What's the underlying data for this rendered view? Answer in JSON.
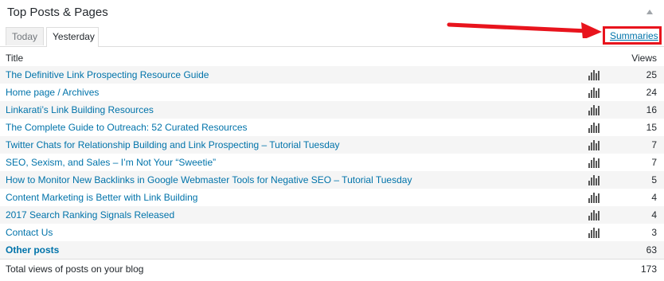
{
  "widget": {
    "title": "Top Posts & Pages"
  },
  "tabs": [
    {
      "label": "Today"
    },
    {
      "label": "Yesterday",
      "active": true
    }
  ],
  "summaries_label": "Summaries",
  "table": {
    "columns": {
      "title": "Title",
      "views": "Views"
    },
    "rows": [
      {
        "title": "The Definitive Link Prospecting Resource Guide",
        "views": "25"
      },
      {
        "title": "Home page / Archives",
        "views": "24"
      },
      {
        "title": "Linkarati’s Link Building Resources",
        "views": "16"
      },
      {
        "title": "The Complete Guide to Outreach: 52 Curated Resources",
        "views": "15"
      },
      {
        "title": "Twitter Chats for Relationship Building and Link Prospecting – Tutorial Tuesday",
        "views": "7"
      },
      {
        "title": "SEO, Sexism, and Sales – I’m Not Your “Sweetie”",
        "views": "7"
      },
      {
        "title": "How to Monitor New Backlinks in Google Webmaster Tools for Negative SEO – Tutorial Tuesday",
        "views": "5"
      },
      {
        "title": "Content Marketing is Better with Link Building",
        "views": "4"
      },
      {
        "title": "2017 Search Ranking Signals Released",
        "views": "4"
      },
      {
        "title": "Contact Us",
        "views": "3"
      }
    ],
    "other": {
      "title": "Other posts",
      "views": "63"
    },
    "total": {
      "title": "Total views of posts on your blog",
      "views": "173"
    }
  },
  "icons": {
    "row_icon": "bar-chart-icon",
    "collapse": "collapse-arrow-icon"
  },
  "colors": {
    "link": "#0073aa",
    "highlight_red": "#e8141d"
  }
}
